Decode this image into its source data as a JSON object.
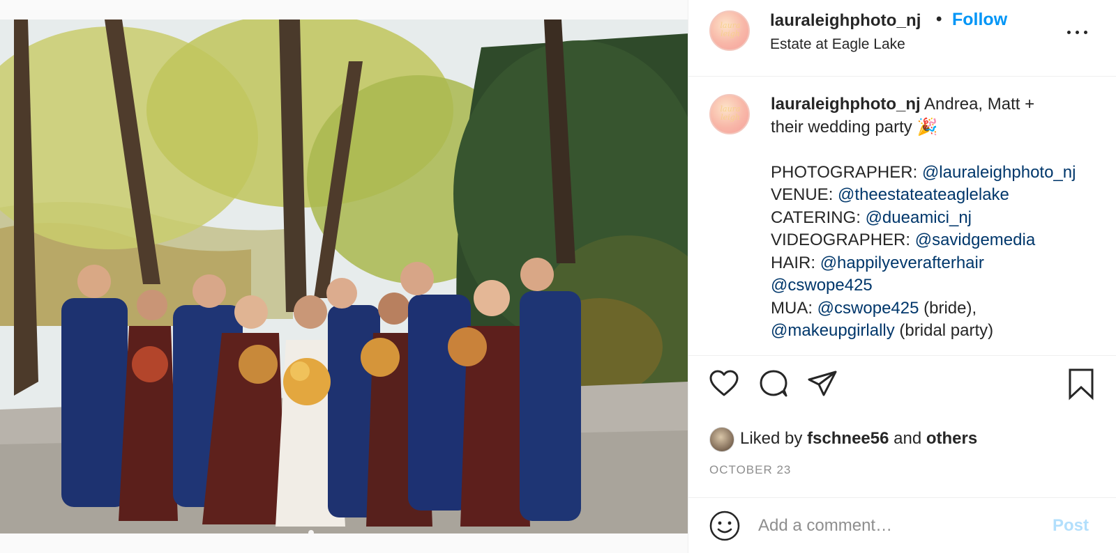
{
  "post": {
    "username": "lauraleighphoto_nj",
    "separator": "•",
    "follow_label": "Follow",
    "location": "Estate at Eagle Lake",
    "avatar_text": "laura leigh"
  },
  "caption": {
    "username": "lauraleighphoto_nj",
    "text_line1": " Andrea, Matt +",
    "text_line2": "their wedding party 🎉",
    "credits": [
      {
        "label": "PHOTOGRAPHER: ",
        "mention": "@lauraleighphoto_nj",
        "suffix": ""
      },
      {
        "label": "VENUE: ",
        "mention": "@theestateateaglelake",
        "suffix": ""
      },
      {
        "label": "CATERING: ",
        "mention": "@dueamici_nj",
        "suffix": ""
      },
      {
        "label": "VIDEOGRAPHER: ",
        "mention": "@savidgemedia",
        "suffix": ""
      },
      {
        "label": "HAIR: ",
        "mention": "@happilyeverafterhair",
        "suffix": ""
      },
      {
        "label": "",
        "mention": "@cswope425",
        "suffix": ""
      },
      {
        "label": "MUA: ",
        "mention": "@cswope425",
        "suffix": " (bride),"
      },
      {
        "label": "",
        "mention": "@makeupgirlally",
        "suffix": " (bridal party)"
      }
    ]
  },
  "actions": {
    "like_icon": "heart-icon",
    "comment_icon": "comment-bubble-icon",
    "share_icon": "paper-plane-icon",
    "save_icon": "bookmark-icon"
  },
  "likes": {
    "prefix": "Liked by ",
    "liker": "fschnee56",
    "and": " and ",
    "others": "others"
  },
  "date": "OCTOBER 23",
  "comment": {
    "placeholder": "Add a comment…",
    "post_label": "Post",
    "emoji_icon": "smiley-icon"
  },
  "colors": {
    "link_blue": "#0095f6",
    "mention_blue": "#00376b",
    "post_disabled": "#b2dffc",
    "muted": "#8e8e8e"
  }
}
